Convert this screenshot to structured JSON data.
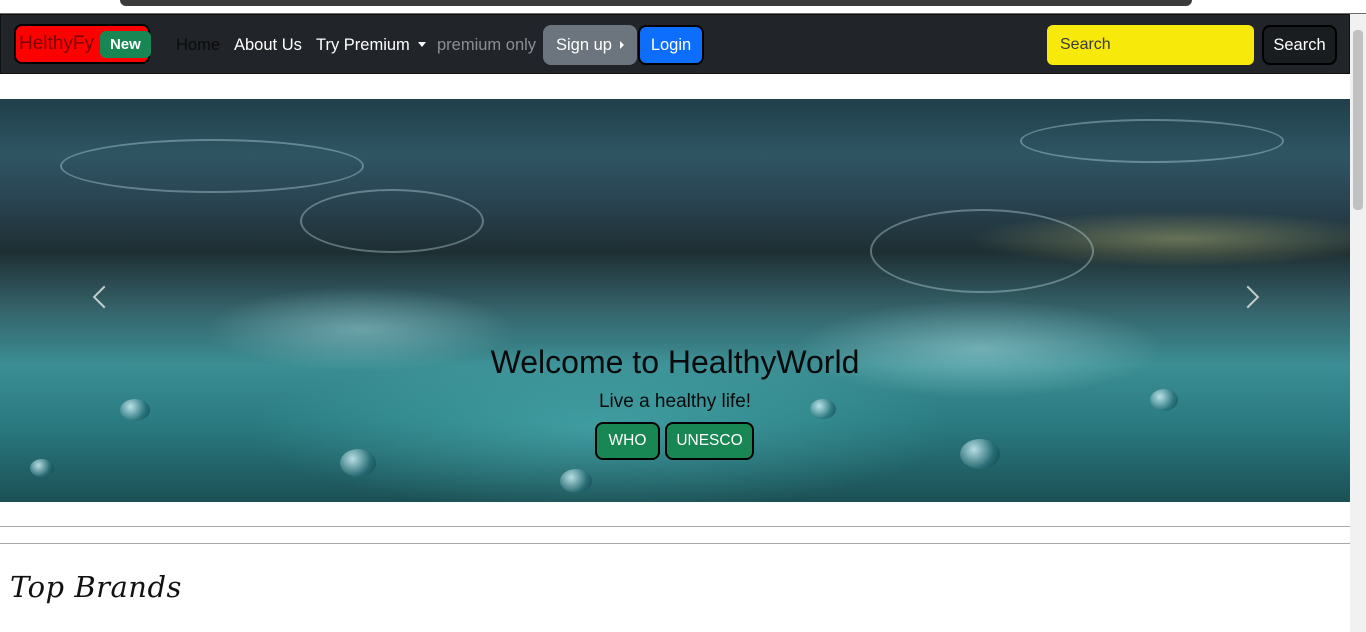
{
  "navbar": {
    "brand": "HelthyFy",
    "brand_badge": "New",
    "links": {
      "home": "Home",
      "about": "About Us",
      "premium": "Try Premium",
      "disabled": "premium only"
    },
    "signup_label": "Sign up",
    "login_label": "Login",
    "search_placeholder": "Search",
    "search_button": "Search"
  },
  "carousel": {
    "title": "Welcome to HealthyWorld",
    "subtitle": "Live a healthy life!",
    "buttons": [
      "WHO",
      "UNESCO"
    ]
  },
  "sections": {
    "top_brands": "Top Brands"
  },
  "colors": {
    "navbar_bg": "#212529",
    "brand_bg": "#ff0000",
    "badge_green": "#198754",
    "login_blue": "#0d6efd",
    "signup_gray": "#6c757d",
    "search_yellow": "#f7ea0a"
  }
}
